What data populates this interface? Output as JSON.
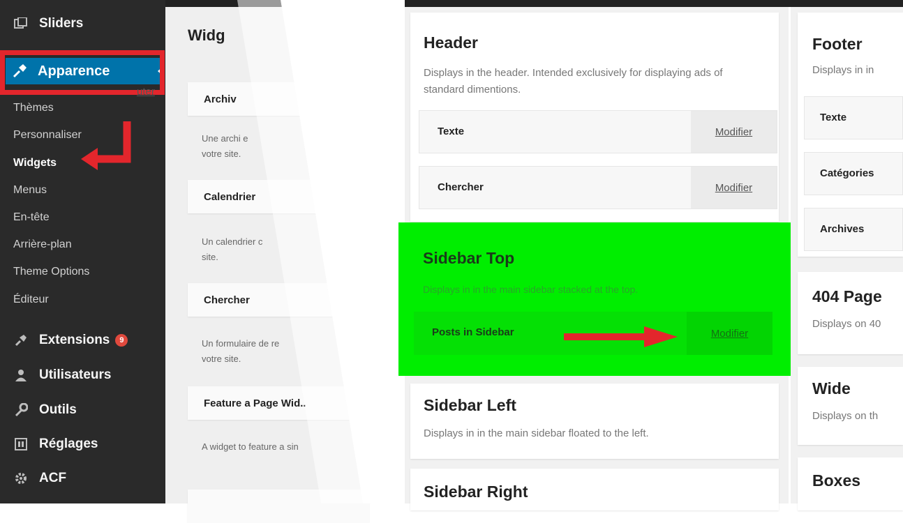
{
  "sidebar": {
    "sliders": "Sliders",
    "apparence": "Apparence",
    "sub_items": [
      "Thèmes",
      "Personnaliser",
      "Widgets",
      "Menus",
      "En-tête",
      "Arrière-plan",
      "Theme Options",
      "Éditeur"
    ],
    "extensions": "Extensions",
    "extensions_badge": "9",
    "utilisateurs": "Utilisateurs",
    "outils": "Outils",
    "reglages": "Réglages",
    "acf": "ACF"
  },
  "available": {
    "title": "Widg",
    "add_link": "uter",
    "widgets": [
      {
        "name": "Archiv",
        "desc": "Une archi                  e\nvotre site."
      },
      {
        "name": "Calendrier",
        "desc": "Un calendrier c\nsite."
      },
      {
        "name": "Chercher",
        "desc": "Un formulaire de re\nvotre site."
      },
      {
        "name": "Feature a Page Wid..",
        "desc": "A widget to feature a sin"
      }
    ]
  },
  "areas": {
    "header": {
      "title": "Header",
      "desc": "Displays in the header. Intended exclusively for displaying ads of standard dimentions.",
      "widgets": [
        "Texte",
        "Chercher"
      ]
    },
    "sidebar_top": {
      "title": "Sidebar Top",
      "desc": "Displays in in the main sidebar stacked at the top.",
      "widget": "Posts in Sidebar"
    },
    "sidebar_left": {
      "title": "Sidebar Left",
      "desc": "Displays in in the main sidebar floated to the left."
    },
    "sidebar_right": {
      "title": "Sidebar Right"
    },
    "edit_label": "Modifier"
  },
  "right": {
    "footer": {
      "title": "Footer",
      "desc": "Displays in in",
      "widgets": [
        "Texte",
        "Catégories",
        "Archives"
      ]
    },
    "page404": {
      "title": "404 Page",
      "desc": "Displays on 40"
    },
    "wide": {
      "title": "Wide",
      "desc": "Displays on th"
    },
    "boxes": {
      "title": "Boxes"
    }
  },
  "colors": {
    "admin_bg": "#2a2a2a",
    "active_blue": "#0073aa",
    "highlight_red": "#e3262c",
    "highlight_green": "#00ee00"
  }
}
